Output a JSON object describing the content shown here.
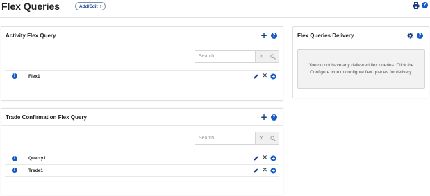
{
  "page": {
    "title": "Flex Queries"
  },
  "header": {
    "add_edit_label": "Add/Edit",
    "print_icon": "print-icon",
    "help_icon": "help-icon",
    "help_glyph": "?"
  },
  "activity_panel": {
    "title": "Activity Flex Query",
    "search": {
      "placeholder": "Search",
      "value": ""
    },
    "rows": [
      {
        "name": "Flex1"
      }
    ]
  },
  "trade_panel": {
    "title": "Trade Confirmation Flex Query",
    "search": {
      "placeholder": "Search",
      "value": ""
    },
    "rows": [
      {
        "name": "Querry1"
      },
      {
        "name": "Trade1"
      }
    ]
  },
  "delivery_panel": {
    "title": "Flex Queries Delivery",
    "message": "You do not have any delivered flex queries. Click the Configure icon to configure flex queries for delivery."
  },
  "glyphs": {
    "plus": "+",
    "info": "i",
    "delete": "✕",
    "clear": "✕",
    "chevron": "›"
  },
  "colors": {
    "accent": "#1559c7",
    "text": "#222222",
    "border": "#e0e0e0"
  }
}
